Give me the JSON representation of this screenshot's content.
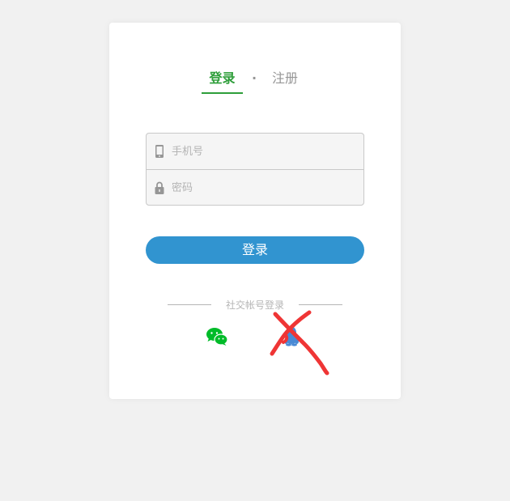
{
  "tabs": {
    "login": "登录",
    "separator": "·",
    "register": "注册"
  },
  "form": {
    "phone_placeholder": "手机号",
    "password_placeholder": "密码"
  },
  "submit_label": "登录",
  "social": {
    "title": "社交帐号登录"
  },
  "colors": {
    "active_tab": "#2e9e3a",
    "submit_bg": "#3194d0",
    "page_bg": "#f1f1f1",
    "wechat": "#00bb29",
    "qq": "#498ad5",
    "scribble": "#ef3535"
  },
  "icons": {
    "phone": "phone-icon",
    "password": "lock-icon",
    "wechat": "wechat-icon",
    "qq": "qq-icon"
  }
}
